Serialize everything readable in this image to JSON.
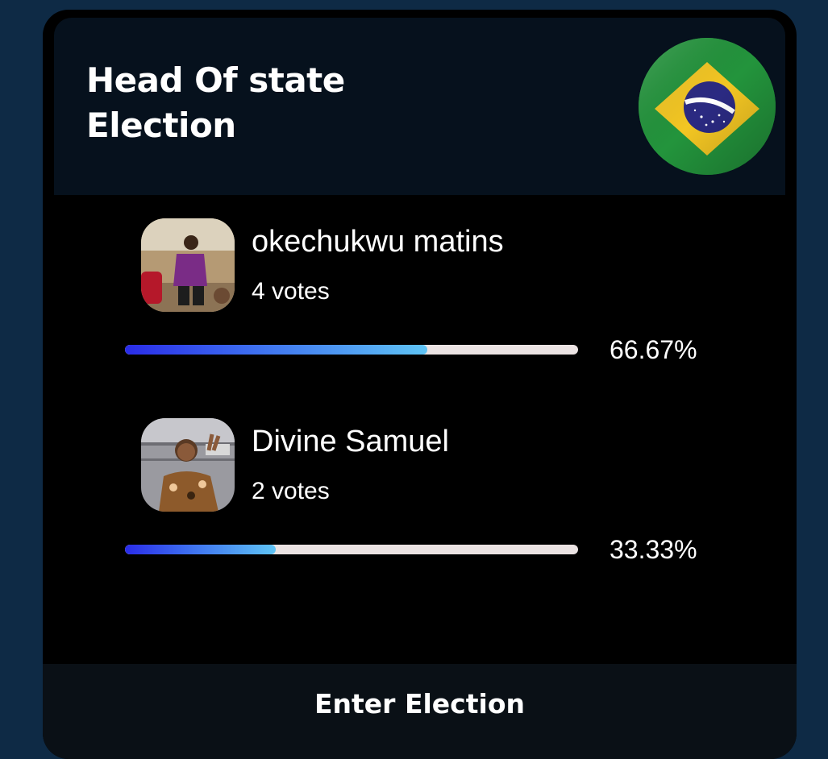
{
  "election": {
    "title": "Head Of state Election",
    "flag_icon": "brazil-flag-icon"
  },
  "candidates": [
    {
      "name": "okechukwu matins",
      "votes": "4 votes",
      "percent": "66.67%",
      "share": 0.6667
    },
    {
      "name": "Divine Samuel",
      "votes": "2 votes",
      "percent": "33.33%",
      "share": 0.3333
    }
  ],
  "footer": {
    "button_label": "Enter Election"
  },
  "colors": {
    "background": "#0e2a45",
    "card": "#000000",
    "header": "#06111d",
    "bar_track": "#ebe3e3",
    "bar_gradient_start": "#2a2ce8",
    "bar_gradient_end": "#5fc4f5"
  }
}
